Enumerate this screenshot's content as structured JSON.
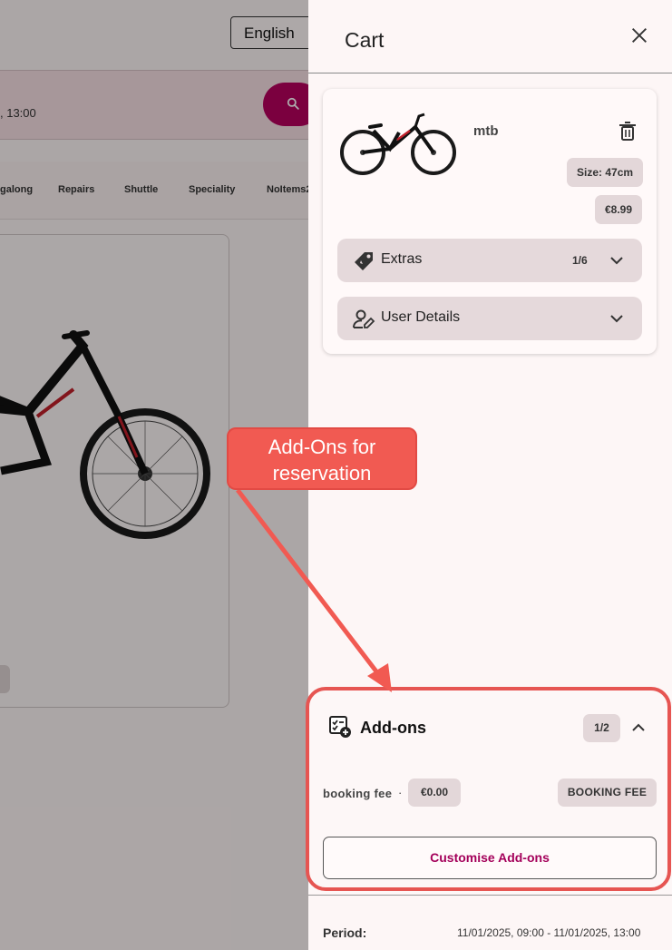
{
  "background": {
    "language": "English",
    "search_time_fragment": ", 13:00",
    "categories": [
      "galong",
      "Repairs",
      "Shuttle",
      "Speciality",
      "NoItems2"
    ]
  },
  "cart": {
    "title": "Cart",
    "item": {
      "name": "mtb",
      "size": "Size: 47cm",
      "price": "€8.99",
      "extras_label": "Extras",
      "extras_count": "1/6",
      "user_details_label": "User Details"
    },
    "addons": {
      "title": "Add-ons",
      "count": "1/2",
      "fee_label": "booking fee",
      "fee_separator": "·",
      "fee_price": "€0.00",
      "fee_badge": "BOOKING FEE",
      "customise_label": "Customise Add-ons"
    },
    "period": {
      "label": "Period:",
      "value": "11/01/2025, 09:00 - 11/01/2025, 13:00"
    }
  },
  "annotation": {
    "callout_line1": "Add-Ons for",
    "callout_line2": "reservation"
  },
  "colors": {
    "accent": "#b5005e",
    "annotation": "#f15a52"
  }
}
